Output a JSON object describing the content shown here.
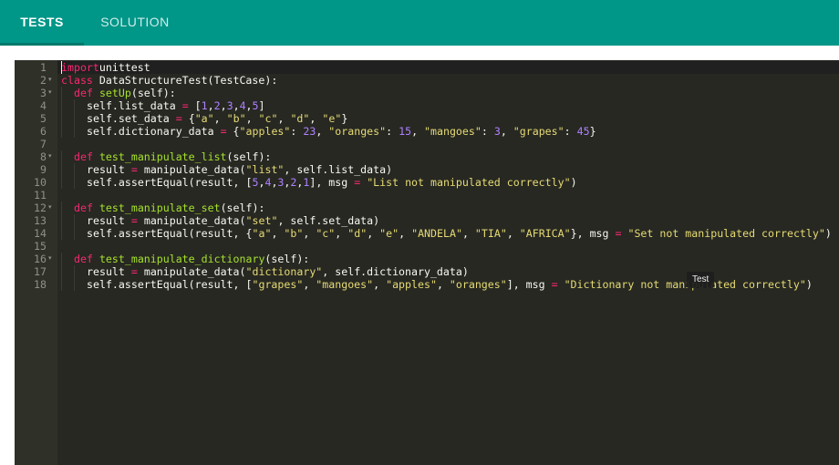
{
  "tabs": [
    {
      "label": "TESTS",
      "active": true
    },
    {
      "label": "SOLUTION",
      "active": false
    }
  ],
  "editor": {
    "lines": [
      {
        "num": "1",
        "fold": false,
        "indent": 0,
        "tokens": [
          [
            "kw",
            "import"
          ],
          [
            "",
            "unittest"
          ]
        ]
      },
      {
        "num": "2",
        "fold": true,
        "indent": 0,
        "tokens": [
          [
            "kw",
            "class"
          ],
          [
            "",
            " "
          ],
          [
            "",
            "DataStructureTest(TestCase):"
          ]
        ]
      },
      {
        "num": "3",
        "fold": true,
        "indent": 1,
        "tokens": [
          [
            "kw",
            "def"
          ],
          [
            "",
            " "
          ],
          [
            "fn",
            "setUp"
          ],
          [
            "",
            "(self):"
          ]
        ]
      },
      {
        "num": "4",
        "fold": false,
        "indent": 2,
        "tokens": [
          [
            "",
            "self.list_data "
          ],
          [
            "kw",
            "="
          ],
          [
            "",
            " ["
          ],
          [
            "num",
            "1"
          ],
          [
            "",
            ","
          ],
          [
            "num",
            "2"
          ],
          [
            "",
            ","
          ],
          [
            "num",
            "3"
          ],
          [
            "",
            ","
          ],
          [
            "num",
            "4"
          ],
          [
            "",
            ","
          ],
          [
            "num",
            "5"
          ],
          [
            "",
            "]"
          ]
        ]
      },
      {
        "num": "5",
        "fold": false,
        "indent": 2,
        "tokens": [
          [
            "",
            "self.set_data "
          ],
          [
            "kw",
            "="
          ],
          [
            "",
            " {"
          ],
          [
            "str",
            "\"a\""
          ],
          [
            "",
            ", "
          ],
          [
            "str",
            "\"b\""
          ],
          [
            "",
            ", "
          ],
          [
            "str",
            "\"c\""
          ],
          [
            "",
            ", "
          ],
          [
            "str",
            "\"d\""
          ],
          [
            "",
            ", "
          ],
          [
            "str",
            "\"e\""
          ],
          [
            "",
            "}"
          ]
        ]
      },
      {
        "num": "6",
        "fold": false,
        "indent": 2,
        "tokens": [
          [
            "",
            "self.dictionary_data "
          ],
          [
            "kw",
            "="
          ],
          [
            "",
            " {"
          ],
          [
            "str",
            "\"apples\""
          ],
          [
            "",
            ": "
          ],
          [
            "num",
            "23"
          ],
          [
            "",
            ", "
          ],
          [
            "str",
            "\"oranges\""
          ],
          [
            "",
            ": "
          ],
          [
            "num",
            "15"
          ],
          [
            "",
            ", "
          ],
          [
            "str",
            "\"mangoes\""
          ],
          [
            "",
            ": "
          ],
          [
            "num",
            "3"
          ],
          [
            "",
            ", "
          ],
          [
            "str",
            "\"grapes\""
          ],
          [
            "",
            ": "
          ],
          [
            "num",
            "45"
          ],
          [
            "",
            "}"
          ]
        ]
      },
      {
        "num": "7",
        "fold": false,
        "indent": 0,
        "tokens": []
      },
      {
        "num": "8",
        "fold": true,
        "indent": 1,
        "tokens": [
          [
            "kw",
            "def"
          ],
          [
            "",
            " "
          ],
          [
            "fn",
            "test_manipulate_list"
          ],
          [
            "",
            "(self):"
          ]
        ]
      },
      {
        "num": "9",
        "fold": false,
        "indent": 2,
        "tokens": [
          [
            "",
            "result "
          ],
          [
            "kw",
            "="
          ],
          [
            "",
            " manipulate_data("
          ],
          [
            "str",
            "\"list\""
          ],
          [
            "",
            ", self.list_data)"
          ]
        ]
      },
      {
        "num": "10",
        "fold": false,
        "indent": 2,
        "tokens": [
          [
            "",
            "self.assertEqual(result, ["
          ],
          [
            "num",
            "5"
          ],
          [
            "",
            ","
          ],
          [
            "num",
            "4"
          ],
          [
            "",
            ","
          ],
          [
            "num",
            "3"
          ],
          [
            "",
            ","
          ],
          [
            "num",
            "2"
          ],
          [
            "",
            ","
          ],
          [
            "num",
            "1"
          ],
          [
            "",
            "], msg "
          ],
          [
            "kw",
            "="
          ],
          [
            "",
            " "
          ],
          [
            "str",
            "\"List not manipulated correctly\""
          ],
          [
            "",
            ")"
          ]
        ]
      },
      {
        "num": "11",
        "fold": false,
        "indent": 0,
        "tokens": []
      },
      {
        "num": "12",
        "fold": true,
        "indent": 1,
        "tokens": [
          [
            "kw",
            "def"
          ],
          [
            "",
            " "
          ],
          [
            "fn",
            "test_manipulate_set"
          ],
          [
            "",
            "(self):"
          ]
        ]
      },
      {
        "num": "13",
        "fold": false,
        "indent": 2,
        "tokens": [
          [
            "",
            "result "
          ],
          [
            "kw",
            "="
          ],
          [
            "",
            " manipulate_data("
          ],
          [
            "str",
            "\"set\""
          ],
          [
            "",
            ", self.set_data)"
          ]
        ]
      },
      {
        "num": "14",
        "fold": false,
        "indent": 2,
        "tokens": [
          [
            "",
            "self.assertEqual(result, {"
          ],
          [
            "str",
            "\"a\""
          ],
          [
            "",
            ", "
          ],
          [
            "str",
            "\"b\""
          ],
          [
            "",
            ", "
          ],
          [
            "str",
            "\"c\""
          ],
          [
            "",
            ", "
          ],
          [
            "str",
            "\"d\""
          ],
          [
            "",
            ", "
          ],
          [
            "str",
            "\"e\""
          ],
          [
            "",
            ", "
          ],
          [
            "str",
            "\"ANDELA\""
          ],
          [
            "",
            ", "
          ],
          [
            "str",
            "\"TIA\""
          ],
          [
            "",
            ", "
          ],
          [
            "str",
            "\"AFRICA\""
          ],
          [
            "",
            "}, msg "
          ],
          [
            "kw",
            "="
          ],
          [
            "",
            " "
          ],
          [
            "str",
            "\"Set not manipulated correctly\""
          ],
          [
            "",
            ")"
          ]
        ]
      },
      {
        "num": "15",
        "fold": false,
        "indent": 0,
        "tokens": []
      },
      {
        "num": "16",
        "fold": true,
        "indent": 1,
        "tokens": [
          [
            "kw",
            "def"
          ],
          [
            "",
            " "
          ],
          [
            "fn",
            "test_manipulate_dictionary"
          ],
          [
            "",
            "(self):"
          ]
        ]
      },
      {
        "num": "17",
        "fold": false,
        "indent": 2,
        "tokens": [
          [
            "",
            "result "
          ],
          [
            "kw",
            "="
          ],
          [
            "",
            " manipulate_data("
          ],
          [
            "str",
            "\"dictionary\""
          ],
          [
            "",
            ", self.dictionary_data)"
          ]
        ]
      },
      {
        "num": "18",
        "fold": false,
        "indent": 2,
        "tokens": [
          [
            "",
            "self.assertEqual(result, ["
          ],
          [
            "str",
            "\"grapes\""
          ],
          [
            "",
            ", "
          ],
          [
            "str",
            "\"mangoes\""
          ],
          [
            "",
            ", "
          ],
          [
            "str",
            "\"apples\""
          ],
          [
            "",
            ", "
          ],
          [
            "str",
            "\"oranges\""
          ],
          [
            "",
            "], msg "
          ],
          [
            "kw",
            "="
          ],
          [
            "",
            " "
          ],
          [
            "str",
            "\"Dictionary not manipulated correctly\""
          ],
          [
            "",
            ")"
          ]
        ]
      }
    ]
  },
  "tooltip": {
    "label": "Test"
  },
  "colors": {
    "tabbar": "#009688",
    "editor_bg": "#272822",
    "gutter_bg": "#2f3129",
    "keyword": "#f92672",
    "function": "#a6e22e",
    "number": "#ae81ff",
    "string": "#e6db74"
  }
}
